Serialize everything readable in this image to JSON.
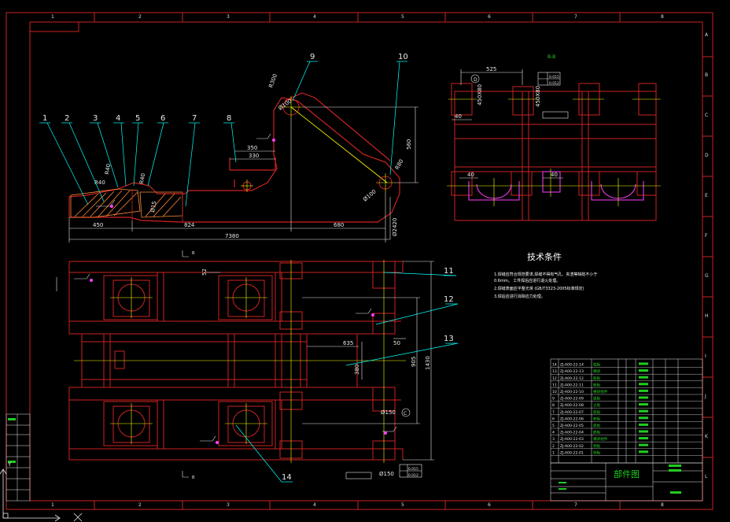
{
  "colors": {
    "background": "#000000",
    "frame": "#cc2222",
    "frame_red": "#d22020",
    "dim": "#e8e8e8",
    "leader": "#00ffff",
    "center": "#ffff00",
    "part": "#ff2020",
    "magenta": "#ff40ff",
    "green": "#22cc22",
    "white": "#ffffff"
  },
  "border_columns": [
    "1",
    "2",
    "3",
    "4",
    "5",
    "6",
    "7",
    "8"
  ],
  "border_rows": [
    "A",
    "B",
    "C",
    "D",
    "E",
    "F",
    "G",
    "H",
    "I",
    "J",
    "K",
    "L"
  ],
  "side_view": {
    "balloons": [
      "1",
      "2",
      "3",
      "4",
      "5",
      "6",
      "7",
      "8",
      "9",
      "10"
    ],
    "dims": {
      "d450": "450",
      "d824": "824",
      "d7380": "7380",
      "d680": "680",
      "d350": "350",
      "d330": "330",
      "d560": "560",
      "r40": "R40",
      "r80": "R80",
      "r300": "R300",
      "d100a": "Ø100",
      "d100b": "Ø100",
      "r40b": "R40",
      "r40c": "R40",
      "dx1": "Ø15",
      "d2420": "Ø2420"
    }
  },
  "section_view": {
    "label": "B-B",
    "dims": {
      "d525": "525",
      "d40a": "40",
      "d40b": "40",
      "d40c": "40",
      "d450": "450X80",
      "d450b": "450X80"
    },
    "tol_a": "0.015",
    "tol_b": "0.012",
    "datum_d": "D"
  },
  "plan_view": {
    "balloons": [
      "11",
      "12",
      "13",
      "14"
    ],
    "dims": {
      "d635": "635",
      "d50": "50",
      "d905": "905",
      "d1430": "1430",
      "d380": "380",
      "d150a": "Ø150",
      "d150b": "Ø150",
      "d52": "52"
    },
    "datum_c": "C",
    "tol_c": "0.015",
    "tol_d": "0.012",
    "section_mark": "B"
  },
  "tech_req": {
    "title": "技术条件",
    "lines": [
      "1.焊缝应符合规范要求,焊缝不得有气孔、夹渣等缺陷不小于",
      "  0.6mm。 工件焊后应进行退火处理。",
      "2.焊缝表面应平整光滑 (GB/T3323-2005标准规定)",
      "3.焊后应进行消除应力处理。"
    ]
  },
  "bom": {
    "rows": [
      [
        "14",
        "ZJ-A00-22-14",
        "底板"
      ],
      [
        "13",
        "ZJ-A00-22-13",
        "横梁"
      ],
      [
        "12",
        "ZJ-A00-22-12",
        "筋板"
      ],
      [
        "11",
        "ZJ-A00-22-11",
        "筋板"
      ],
      [
        "10",
        "ZJ-A00-22-10",
        "横梁组件"
      ],
      [
        "9",
        "ZJ-A00-22-09",
        "底板"
      ],
      [
        "8",
        "ZJ-A00-22-08",
        "立板"
      ],
      [
        "7",
        "ZJ-A00-22-07",
        "底板"
      ],
      [
        "6",
        "ZJ-A00-22-06",
        "筋板"
      ],
      [
        "5",
        "ZJ-A00-22-05",
        "底板"
      ],
      [
        "4",
        "ZJ-A00-22-04",
        "筋板"
      ],
      [
        "3",
        "ZJ-A00-22-03",
        "横梁组件"
      ],
      [
        "2",
        "ZJ-A00-22-02",
        "侧板"
      ],
      [
        "1",
        "ZJ-A00-22-01",
        "侧板"
      ]
    ],
    "title_block_name": "部件图"
  },
  "title_block": {
    "name": "部件图"
  },
  "corner": {
    "ucs_y": "Y",
    "ucs_x": "X"
  }
}
